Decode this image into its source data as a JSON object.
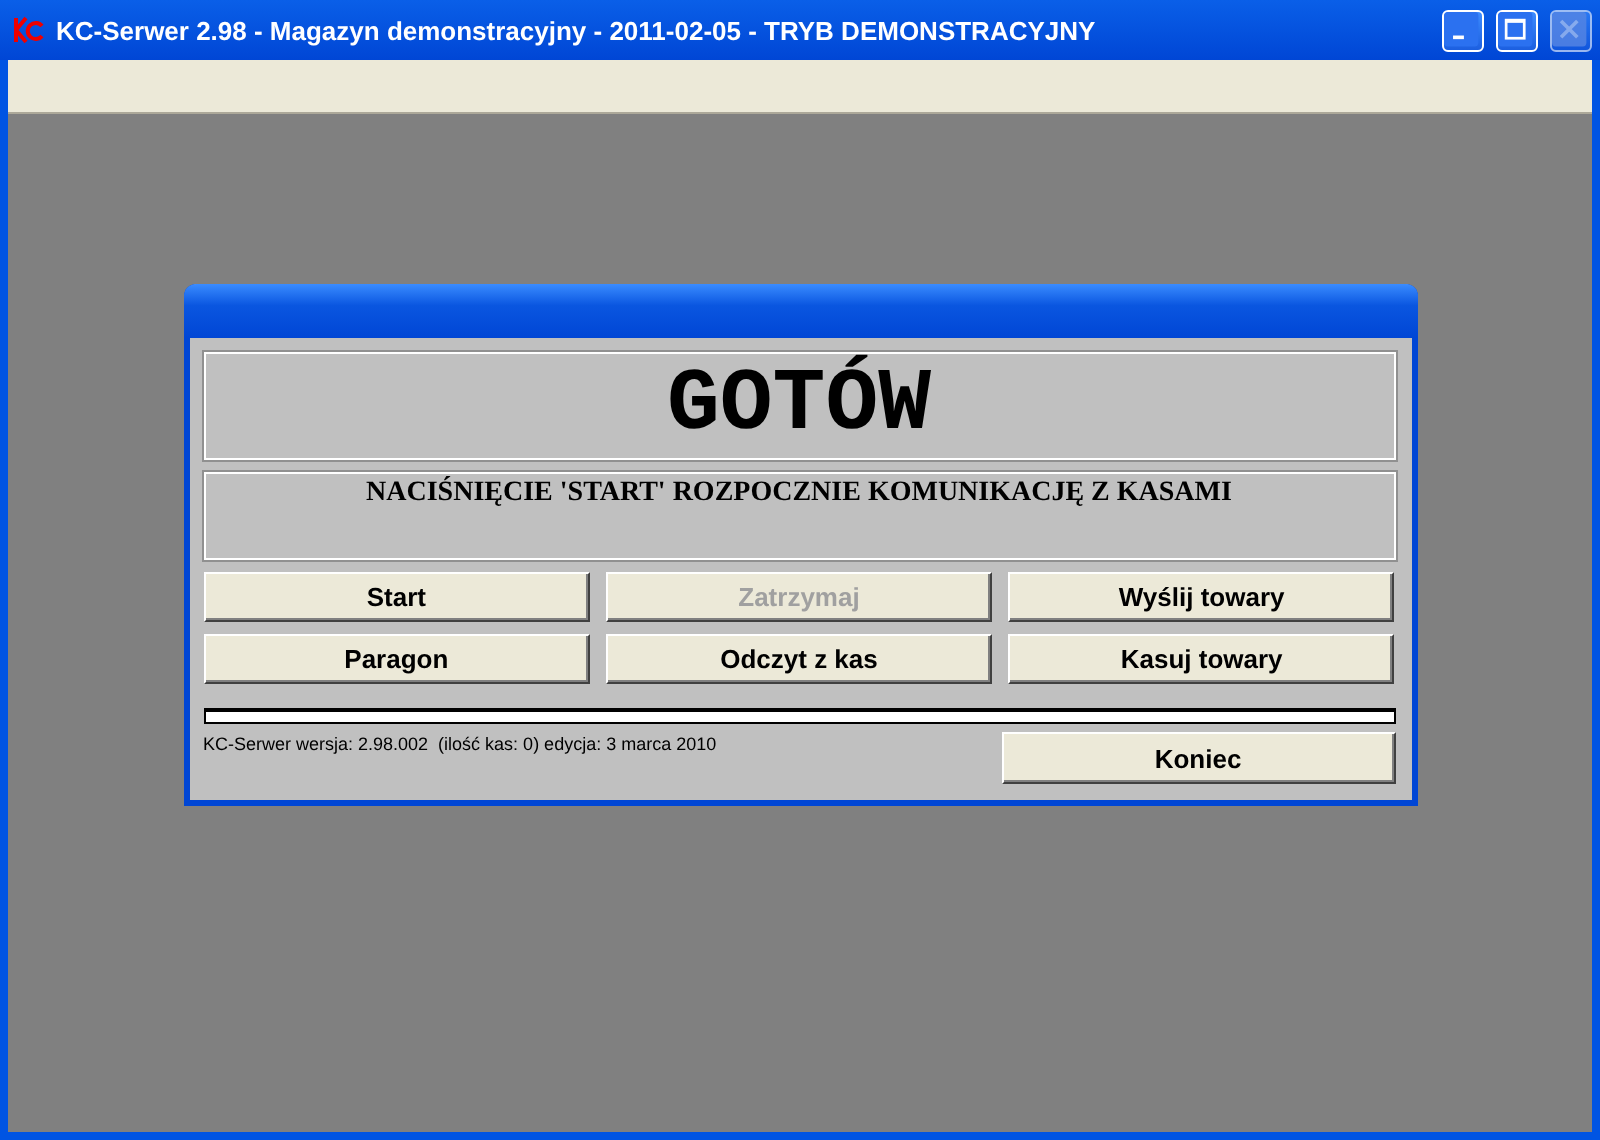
{
  "window": {
    "title": "KC-Serwer 2.98 - Magazyn demonstracyjny - 2011-02-05 - TRYB DEMONSTRACYJNY"
  },
  "dialog": {
    "status": "GOTÓW",
    "message": "NACIŚNIĘCIE 'START' ROZPOCZNIE KOMUNIKACJĘ Z KASAMI",
    "buttons": [
      {
        "label": "Start",
        "disabled": false
      },
      {
        "label": "Zatrzymaj",
        "disabled": true
      },
      {
        "label": "Wyślij towary",
        "disabled": false
      },
      {
        "label": "Paragon",
        "disabled": false
      },
      {
        "label": "Odczyt z kas",
        "disabled": false
      },
      {
        "label": "Kasuj towary",
        "disabled": false
      }
    ],
    "progress": {
      "level": 0
    },
    "version_info": "KC-Serwer wersja: 2.98.002  (ilość kas: 0) edycja: 3 marca 2010",
    "close_button": {
      "label": "Koniec",
      "disabled": false
    }
  }
}
